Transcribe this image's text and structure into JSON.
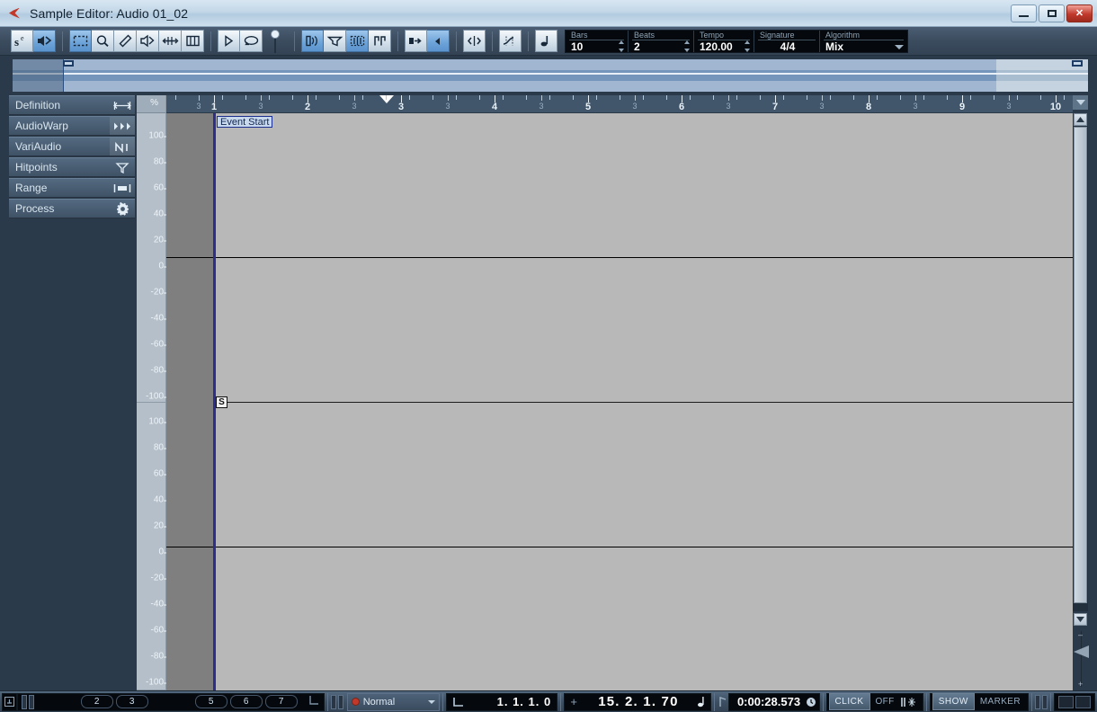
{
  "window": {
    "title": "Sample Editor: Audio 01_02",
    "app_icon": "cubase-logo-icon",
    "minimize_label": "",
    "maximize_label": "",
    "close_label": "✕"
  },
  "toolbar": {
    "left_tools": [
      {
        "name": "solo-editor-button",
        "icon": "s-superscript-e-icon",
        "active": false
      },
      {
        "name": "acoustic-feedback-button",
        "icon": "speaker-arrow-icon",
        "active": true
      }
    ],
    "edit_tools": [
      {
        "name": "object-selection-tool",
        "icon": "dashed-rectangle-icon",
        "active": true
      },
      {
        "name": "zoom-tool",
        "icon": "magnifier-icon",
        "active": false
      },
      {
        "name": "draw-tool",
        "icon": "pencil-icon",
        "active": false
      },
      {
        "name": "play-tool",
        "icon": "speaker-icon",
        "active": false
      },
      {
        "name": "scrub-tool",
        "icon": "double-arrow-icon",
        "active": false
      },
      {
        "name": "time-warp-tool",
        "icon": "columns-icon",
        "active": false
      }
    ],
    "transport_tools": [
      {
        "name": "play-button",
        "icon": "play-triangle-icon",
        "active": false
      },
      {
        "name": "loop-button",
        "icon": "loop-ellipse-icon",
        "active": false
      }
    ],
    "volume_slider": {
      "name": "editor-volume-slider"
    },
    "view_tools": [
      {
        "name": "show-audio-event-button",
        "icon": "event-bracket-icon",
        "active": true
      },
      {
        "name": "show-region-button",
        "icon": "region-funnel-icon",
        "active": false
      },
      {
        "name": "show-fades-button",
        "icon": "dashed-select-icon",
        "active": true
      },
      {
        "name": "show-hitpoints-button",
        "icon": "two-bars-icon",
        "active": false
      }
    ],
    "snap_tools": [
      {
        "name": "snap-button",
        "icon": "snap-magnet-icon",
        "active": true
      },
      {
        "name": "snap-dropdown",
        "icon": "left-triangle-icon",
        "active": true
      }
    ],
    "extra_tools": [
      {
        "name": "zero-crossing-button",
        "icon": "zero-cross-icon",
        "active": false
      },
      {
        "name": "musical-mode-button",
        "icon": "curve-icon",
        "active": false
      },
      {
        "name": "note-value-button",
        "icon": "quarter-note-icon",
        "active": false
      }
    ],
    "info_fields": [
      {
        "name": "bars-field",
        "label": "Bars",
        "value": "10",
        "spinner": true,
        "align": "left"
      },
      {
        "name": "beats-field",
        "label": "Beats",
        "value": "2",
        "spinner": true,
        "align": "left"
      },
      {
        "name": "tempo-field",
        "label": "Tempo",
        "value": "120.00",
        "spinner": true,
        "align": "left"
      },
      {
        "name": "signature-field",
        "label": "Signature",
        "value": "4/4",
        "spinner": false,
        "align": "center"
      },
      {
        "name": "algorithm-field",
        "label": "Algorithm",
        "value": "Mix",
        "spinner": false,
        "align": "left",
        "dropdown": true
      }
    ]
  },
  "inspector": {
    "items": [
      {
        "label": "Definition",
        "icon": "left-right-arrow-icon",
        "glyph": "⇤⇥",
        "highlight": false
      },
      {
        "label": "AudioWarp",
        "icon": "triple-chevron-icon",
        "glyph": "▸▸▸",
        "highlight": true
      },
      {
        "label": "VariAudio",
        "icon": "pitch-segment-icon",
        "glyph": "↗",
        "highlight": true
      },
      {
        "label": "Hitpoints",
        "icon": "funnel-icon",
        "glyph": "⧨",
        "highlight": false
      },
      {
        "label": "Range",
        "icon": "range-bar-icon",
        "glyph": "▐▬▌",
        "highlight": false
      },
      {
        "label": "Process",
        "icon": "gear-icon",
        "glyph": "⚙",
        "highlight": false
      }
    ]
  },
  "value_ruler": {
    "unit": "%",
    "ticks": [
      100,
      80,
      60,
      40,
      20,
      0,
      -20,
      -40,
      -60,
      -80,
      -100
    ]
  },
  "ruler": {
    "bars": [
      {
        "label": "3",
        "pos": 36,
        "sub": true
      },
      {
        "label": "1",
        "pos": 53,
        "sub": false
      },
      {
        "label": "3",
        "pos": 105,
        "sub": true
      },
      {
        "label": "2",
        "pos": 157,
        "sub": false
      },
      {
        "label": "3",
        "pos": 209,
        "sub": true
      },
      {
        "label": "3",
        "pos": 261,
        "sub": false
      },
      {
        "label": "3",
        "pos": 313,
        "sub": true
      },
      {
        "label": "4",
        "pos": 365,
        "sub": false
      },
      {
        "label": "3",
        "pos": 417,
        "sub": true
      },
      {
        "label": "5",
        "pos": 469,
        "sub": false
      },
      {
        "label": "3",
        "pos": 521,
        "sub": true
      },
      {
        "label": "6",
        "pos": 573,
        "sub": false
      },
      {
        "label": "3",
        "pos": 625,
        "sub": true
      },
      {
        "label": "7",
        "pos": 677,
        "sub": false
      },
      {
        "label": "3",
        "pos": 729,
        "sub": true
      },
      {
        "label": "8",
        "pos": 781,
        "sub": false
      },
      {
        "label": "3",
        "pos": 833,
        "sub": true
      },
      {
        "label": "9",
        "pos": 885,
        "sub": false
      },
      {
        "label": "3",
        "pos": 937,
        "sub": true
      },
      {
        "label": "10",
        "pos": 989,
        "sub": false
      }
    ]
  },
  "waveform": {
    "event_start_label": "Event Start",
    "snap_handle_label": "S",
    "channels": 2,
    "background_color": "#b8b8b8",
    "pre_event_color": "#7f7f7f",
    "event_line_color": "#2d2d8f"
  },
  "transport": {
    "marker_numbers": [
      "2",
      "3",
      "5",
      "6",
      "7"
    ],
    "mode": "Normal",
    "left_locator": "1. 1. 1.  0",
    "position": "15. 2. 1. 70",
    "time": "0:00:28.573",
    "click_label": "CLICK",
    "click_state": "OFF",
    "show_label": "SHOW",
    "marker_label": "MARKER"
  }
}
